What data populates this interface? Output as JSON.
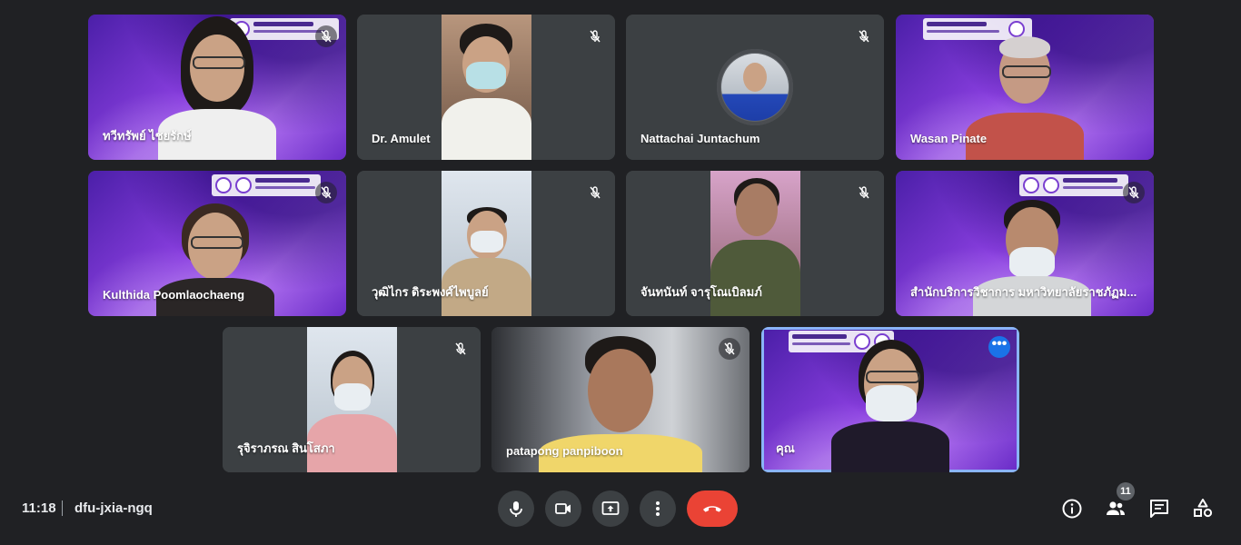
{
  "participants": [
    {
      "name": "ทวีทรัพย์ ไชยรักษ์"
    },
    {
      "name": "Dr. Amulet"
    },
    {
      "name": "Nattachai Juntachum"
    },
    {
      "name": "Wasan Pinate"
    },
    {
      "name": "Kulthida Poomlaochaeng"
    },
    {
      "name": "วุฒิไกร ดิระพงศ์ไพบูลย์"
    },
    {
      "name": "จันทนันท์ จารุโณเบิลมภ์"
    },
    {
      "name": "สำนักบริการวิชาการ มหาวิทยาลัยราชภัฏม..."
    },
    {
      "name": "รุจิราภรณ สินโสภา"
    },
    {
      "name": "patapong panpiboon"
    },
    {
      "name": "คุณ"
    }
  ],
  "more_options_label": "•••",
  "meeting": {
    "time": "11:18",
    "code": "dfu-jxia-ngq"
  },
  "people_count": "11",
  "colors": {
    "accent": "#1a73e8",
    "end_call": "#ea4335",
    "background": "#202124"
  }
}
